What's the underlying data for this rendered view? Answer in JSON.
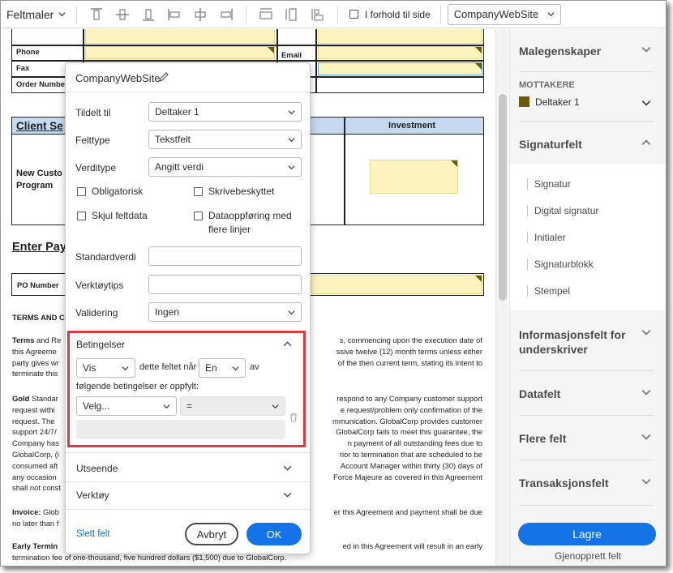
{
  "toolbar": {
    "title": "Feltmaler",
    "checkbox_label": "I forhold til side",
    "dropdown_value": "CompanyWebSite"
  },
  "document": {
    "labels": {
      "phone": "Phone",
      "fax": "Fax",
      "order_number": "Order Numbe",
      "email": "Email",
      "client_section": "Client Se",
      "investment": "Investment",
      "new_customer_1": "New Custo",
      "new_customer_2": "Program",
      "enter_pay": "Enter Pay",
      "po_number": "PO Number",
      "terms_heading": "TERMS AND C"
    },
    "para1": [
      {
        "left": "Terms and Re",
        "right": "s, commencing upon the execution date of"
      },
      {
        "left": "this Agreeme",
        "right": "ssive twelve (12) month terms unless either"
      },
      {
        "left": "party gives wr",
        "right": "of the then current term, stating its intent to"
      },
      {
        "left": "terminate this",
        "right": ""
      }
    ],
    "para2": [
      {
        "left": "Gold Standar",
        "right": "respond to any Company customer support"
      },
      {
        "left": "request withi",
        "right": "e request/problem only confirmation of the"
      },
      {
        "left": "request. The",
        "right": "mmunication. GlobalCorp provides customer"
      },
      {
        "left": "support 24/7/",
        "right": "GlobalCorp fails to meet this guarantee, the"
      },
      {
        "left": "Company has",
        "right": "n payment of all outstanding fees due to"
      },
      {
        "left": "GlobalCorp, (i",
        "right": "rior to termination that are scheduled to be"
      },
      {
        "left": "consumed aft",
        "right": "Account Manager within thirty (30) days of"
      },
      {
        "left": "any occasion",
        "right": "Force Majeure as covered in this Agreement"
      },
      {
        "left": "shall not const",
        "right": ""
      }
    ],
    "para3": [
      {
        "left": "Invoice: Glob",
        "right": "er this Agreement and payment shall be due"
      },
      {
        "left": "no later than f",
        "right": ""
      }
    ],
    "para4": [
      {
        "left": "Early Termin",
        "right": "ed in this Agreement will result in an early"
      },
      {
        "left": "termination fee of one-thousand, five hundred dollars ($1,500) due to GlobalCorp.",
        "right": ""
      }
    ]
  },
  "dialog": {
    "title": "CompanyWebSite",
    "assigned_label": "Tildelt til",
    "assigned_value": "Deltaker 1",
    "fieldtype_label": "Felttype",
    "fieldtype_value": "Tekstfelt",
    "valuetype_label": "Verditype",
    "valuetype_value": "Angitt verdi",
    "required": "Obligatorisk",
    "readonly": "Skrivebeskyttet",
    "hide_data": "Skjul feltdata",
    "multiline_1": "Dataoppføring med",
    "multiline_2": "flere linjer",
    "default_label": "Standardverdi",
    "tooltip_label": "Verktøytips",
    "validation_label": "Validering",
    "validation_value": "Ingen",
    "conditions": {
      "heading": "Betingelser",
      "action_value": "Vis",
      "text1": "dette feltet når",
      "quantifier_value": "En",
      "text2": "av",
      "text3": "følgende betingelser er oppfylt:",
      "field_select": "Velg...",
      "operator_select": "="
    },
    "appearance": "Utseende",
    "tools": "Verktøy",
    "delete_link": "Slett felt",
    "cancel": "Avbryt",
    "ok": "OK"
  },
  "panel": {
    "properties": "Malegenskaper",
    "recipients_label": "MOTTAKERE",
    "recipient": "Deltaker 1",
    "recipient_color": "#6b5a0c",
    "signature_fields": "Signaturfelt",
    "signature_items": [
      "Signatur",
      "Digital signatur",
      "Initialer",
      "Signaturblokk",
      "Stempel"
    ],
    "signer_info_1": "Informasjonsfelt for",
    "signer_info_2": "underskriver",
    "data_fields": "Datafelt",
    "more_fields": "Flere felt",
    "transaction_fields": "Transaksjonsfelt",
    "save": "Lagre",
    "restore": "Gjenopprett felt"
  },
  "colors": {
    "accent": "#1473e6",
    "highlight": "#e0383e",
    "field_fill": "#fdf3bf",
    "header_fill": "#c5d9f1"
  }
}
